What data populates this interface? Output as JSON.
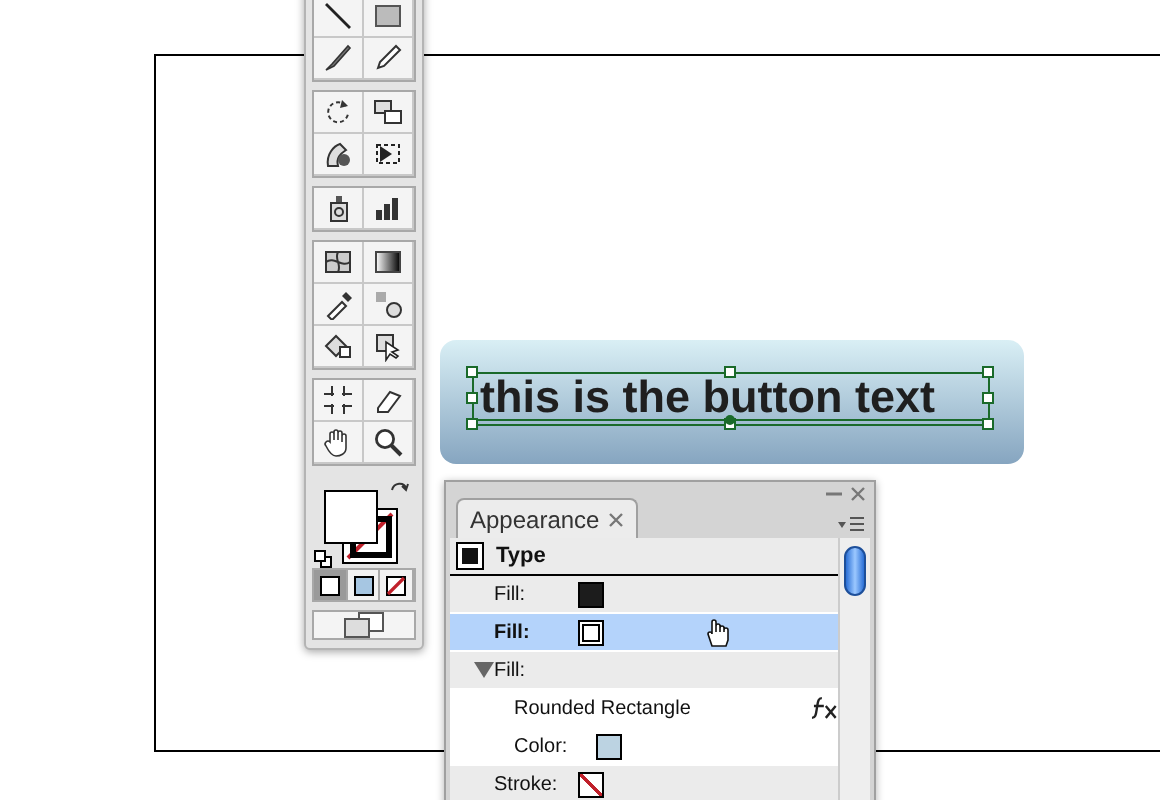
{
  "artboard": {
    "button_text": "this is the button text"
  },
  "tools": {
    "draw_modes": [
      {
        "kind": "normal",
        "selected": true
      },
      {
        "kind": "behind",
        "selected": false
      },
      {
        "kind": "inside",
        "selected": false
      }
    ]
  },
  "appearance_panel": {
    "tab": {
      "label": "Appearance",
      "selected": true
    },
    "rows": [
      {
        "kind": "header",
        "label": "Type",
        "selected": false
      },
      {
        "kind": "attribute",
        "label": "Fill:",
        "selected": false,
        "swatch": {
          "kind": "solid",
          "color": "#1c1c1c"
        }
      },
      {
        "kind": "attribute",
        "label": "Fill:",
        "selected": true,
        "swatch": {
          "kind": "solid",
          "color": "#ffffff"
        }
      },
      {
        "kind": "group",
        "label": "Fill:",
        "selected": false,
        "expanded": true
      },
      {
        "kind": "effect",
        "label": "Rounded Rectangle",
        "selected": false
      },
      {
        "kind": "property",
        "label": "Color:",
        "selected": false,
        "swatch": {
          "kind": "solid",
          "color": "#bcd3e2"
        }
      },
      {
        "kind": "attribute",
        "label": "Stroke:",
        "selected": false,
        "swatch": {
          "kind": "none"
        }
      }
    ]
  }
}
